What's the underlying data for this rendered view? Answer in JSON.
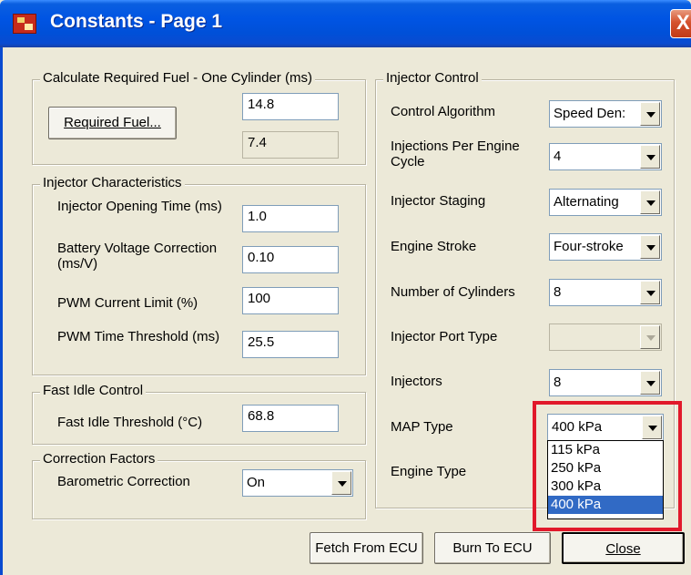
{
  "window": {
    "title": "Constants - Page 1",
    "close_glyph": "X"
  },
  "required_fuel": {
    "group_title": "Calculate Required Fuel - One Cylinder (ms)",
    "button_label": "Required Fuel...",
    "value": "14.8",
    "computed": "7.4"
  },
  "injector_characteristics": {
    "group_title": "Injector Characteristics",
    "opening_time": {
      "label": "Injector Opening Time (ms)",
      "value": "1.0"
    },
    "battery_voltage": {
      "label": "Battery Voltage Correction (ms/V)",
      "value": "0.10"
    },
    "pwm_current": {
      "label": "PWM Current Limit (%)",
      "value": "100"
    },
    "pwm_time": {
      "label": "PWM Time Threshold (ms)",
      "value": "25.5"
    }
  },
  "fast_idle": {
    "group_title": "Fast Idle Control",
    "threshold": {
      "label": "Fast Idle Threshold (°C)",
      "value": "68.8"
    }
  },
  "correction_factors": {
    "group_title": "Correction Factors",
    "barometric": {
      "label": "Barometric Correction",
      "value": "On"
    }
  },
  "injector_control": {
    "group_title": "Injector Control",
    "control_algorithm": {
      "label": "Control Algorithm",
      "value": "Speed Den:"
    },
    "injections_per_cycle": {
      "label": "Injections Per Engine Cycle",
      "value": "4"
    },
    "injector_staging": {
      "label": "Injector Staging",
      "value": "Alternating"
    },
    "engine_stroke": {
      "label": "Engine Stroke",
      "value": "Four-stroke"
    },
    "num_cylinders": {
      "label": "Number of Cylinders",
      "value": "8"
    },
    "injector_port_type": {
      "label": "Injector Port Type",
      "value": ""
    },
    "injectors": {
      "label": "Injectors",
      "value": "8"
    },
    "map_type": {
      "label": "MAP Type",
      "value": "400 kPa"
    },
    "engine_type": {
      "label": "Engine Type"
    }
  },
  "map_dropdown": {
    "options": [
      "115 kPa",
      "250 kPa",
      "300 kPa",
      "400 kPa"
    ],
    "selected": "400 kPa"
  },
  "footer": {
    "fetch_label": "Fetch From ECU",
    "burn_label": "Burn To ECU",
    "close_label": "Close"
  },
  "colors": {
    "title_bar": "#0054e3",
    "highlight_box": "#e1192b",
    "selection": "#316ac5",
    "dialog_bg": "#ece9d8"
  }
}
